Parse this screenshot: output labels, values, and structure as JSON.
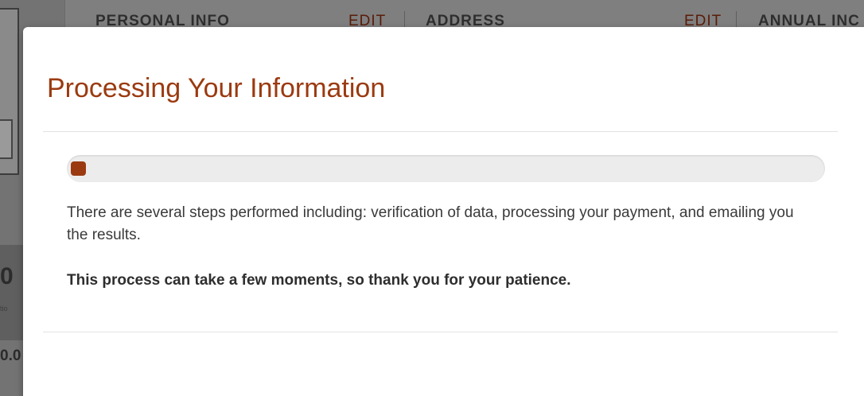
{
  "background": {
    "columns": [
      {
        "header": "PERSONAL INFO",
        "action": "EDIT"
      },
      {
        "header": "ADDRESS",
        "action": "EDIT"
      },
      {
        "header": "ANNUAL INC"
      }
    ],
    "left_fragments": {
      "big": "0",
      "small": "tio",
      "money": "0.0"
    }
  },
  "modal": {
    "title": "Processing Your Information",
    "progress": {
      "percent": 2,
      "color": "#9b3a10"
    },
    "description": "There are several steps performed including: verification of data, processing your payment, and emailing you the results.",
    "emphasis": "This process can take a few moments, so thank you for your patience."
  },
  "colors": {
    "accent": "#9b3a10",
    "overlay": "#7b7b7b"
  }
}
